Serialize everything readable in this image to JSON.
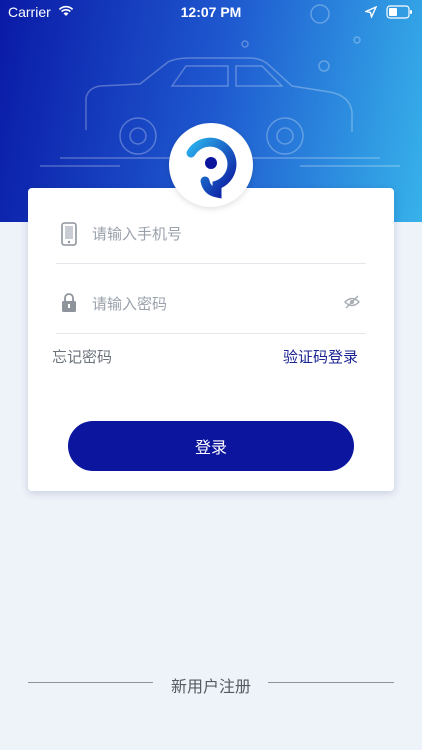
{
  "status_bar": {
    "carrier": "Carrier",
    "time": "12:07 PM"
  },
  "login": {
    "phone_placeholder": "请输入手机号",
    "password_placeholder": "请输入密码",
    "forgot_password": "忘记密码",
    "sms_login": "验证码登录",
    "submit": "登录"
  },
  "footer": {
    "register": "新用户注册"
  },
  "colors": {
    "primary": "#0c159e",
    "hero_start": "#0a1aa6",
    "hero_end": "#37b2ea",
    "background": "#eef2f9"
  },
  "icons": [
    "wifi-icon",
    "location-icon",
    "battery-icon",
    "app-logo",
    "phone-icon",
    "lock-icon",
    "eye-hidden-icon"
  ]
}
